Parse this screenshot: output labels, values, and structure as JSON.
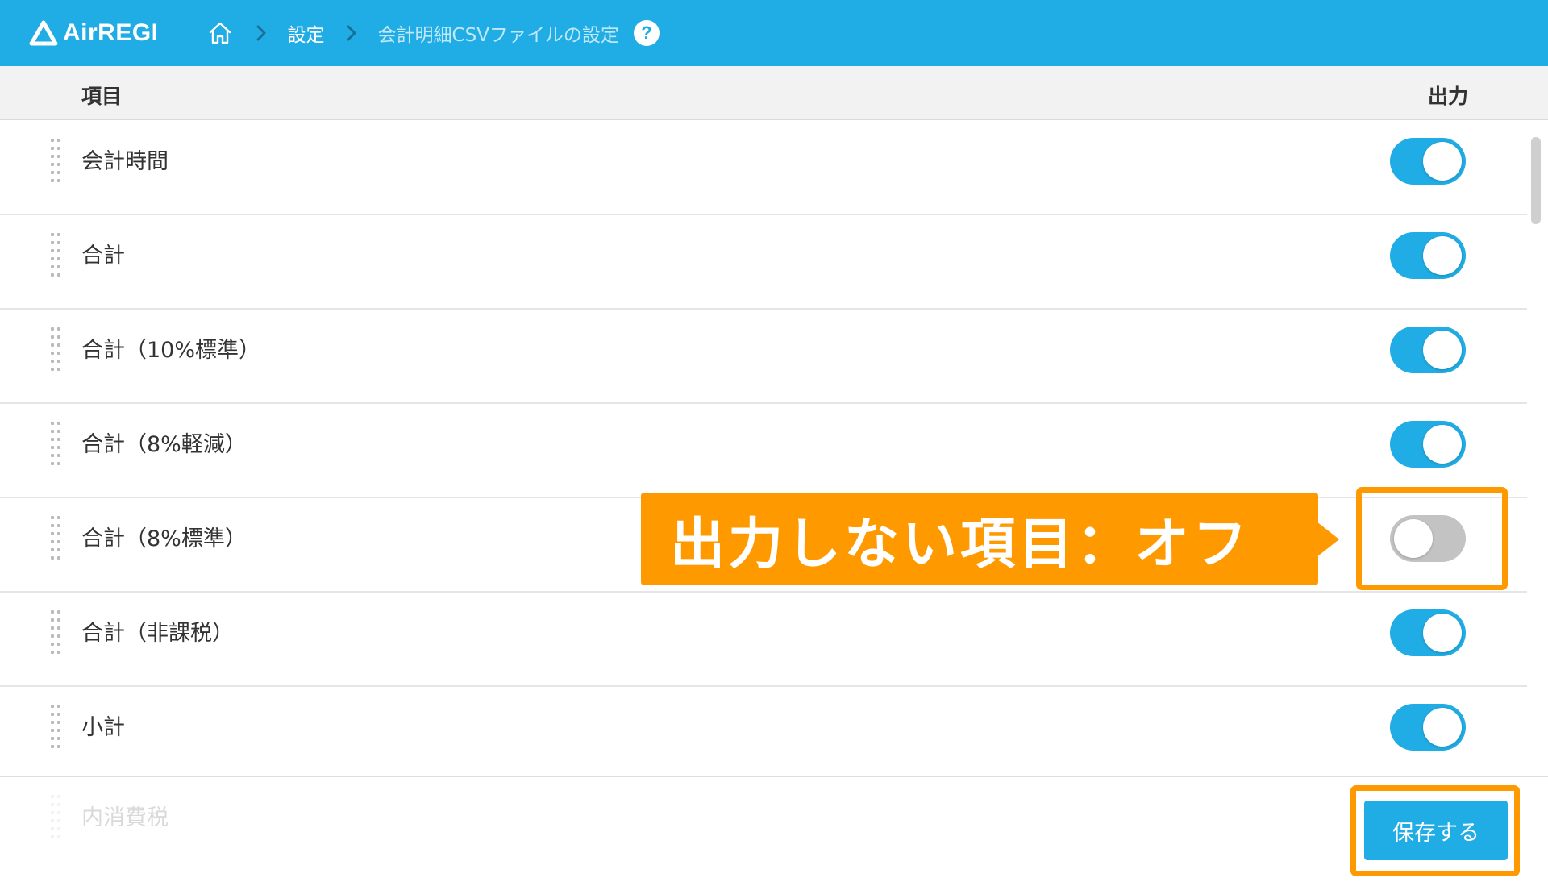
{
  "header": {
    "logo_text": "AirREGI",
    "breadcrumb": {
      "home_icon": "home-icon",
      "settings": "設定",
      "current": "会計明細CSVファイルの設定"
    },
    "help_label": "?"
  },
  "columns": {
    "item": "項目",
    "output": "出力"
  },
  "rows": [
    {
      "label": "会計時間",
      "enabled": true
    },
    {
      "label": "合計",
      "enabled": true
    },
    {
      "label": "合計（10%標準）",
      "enabled": true
    },
    {
      "label": "合計（8%軽減）",
      "enabled": true
    },
    {
      "label": "合計（8%標準）",
      "enabled": false
    },
    {
      "label": "合計（非課税）",
      "enabled": true
    },
    {
      "label": "小計",
      "enabled": true
    },
    {
      "label": "内消費税",
      "enabled": true
    }
  ],
  "footer": {
    "save_label": "保存する"
  },
  "annotation": {
    "callout_text": "出力しない項目：オフ"
  },
  "colors": {
    "brand_blue": "#20ACE4",
    "annotation_orange": "#FF9900",
    "toggle_off": "#C3C3C3"
  }
}
